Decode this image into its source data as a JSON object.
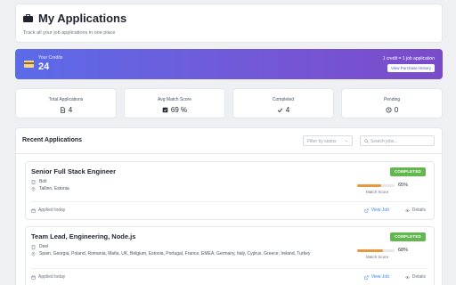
{
  "header": {
    "title": "My Applications",
    "subtitle": "Track all your job applications in one place"
  },
  "credits": {
    "label": "Your Credits",
    "value": "24",
    "rate": "1 credit = 1 job application",
    "history_button": "View Purchase History"
  },
  "stats": [
    {
      "label": "Total Applications",
      "value": "4",
      "icon": "document-icon"
    },
    {
      "label": "Avg Match Score",
      "value": "69 %",
      "icon": "check-square-icon"
    },
    {
      "label": "Completed",
      "value": "4",
      "icon": "check-icon"
    },
    {
      "label": "Pending",
      "value": "0",
      "icon": "clock-icon"
    }
  ],
  "applications": {
    "title": "Recent Applications",
    "filter_placeholder": "Filter by status",
    "search_placeholder": "Search jobs...",
    "jobs": [
      {
        "title": "Senior Full Stack Engineer",
        "company": "Bolt",
        "location": "Tallinn, Estonia",
        "status": "COMPLETED",
        "match_score": 0.65,
        "match_text": "65%",
        "match_label": "Match Score",
        "applied": "Applied today",
        "view_label": "View Job",
        "details_label": "Details"
      },
      {
        "title": "Team Lead, Engineering, Node.js",
        "company": "Deel",
        "location": "Spain, Georgia, Poland, Romania, Malta, UK, Belgium, Estonia, Portugal, France, EMEA, Germany, Italy, Cyprus, Greece, Ireland, Turkey",
        "status": "COMPLETED",
        "match_score": 0.68,
        "match_text": "68%",
        "match_label": "Match Score",
        "applied": "Applied today",
        "view_label": "View Job",
        "details_label": "Details"
      }
    ]
  },
  "colors": {
    "accent_gradient_start": "#5b6be8",
    "accent_gradient_end": "#7a4bc9",
    "status_completed": "#62b84f",
    "match_bar": "#e8973a",
    "link": "#3b82f6"
  }
}
